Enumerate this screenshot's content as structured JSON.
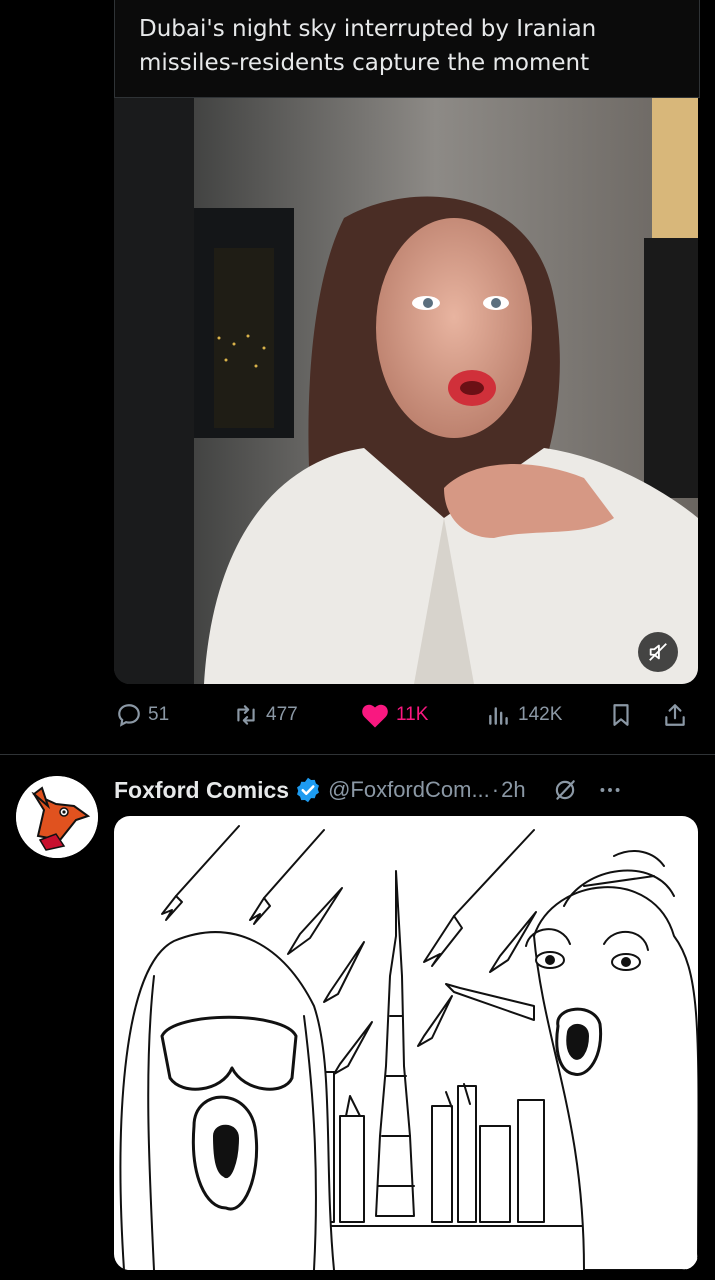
{
  "post": {
    "caption": "Dubai's night sky interrupted by Iranian missiles-residents capture the moment"
  },
  "actions": {
    "replies": "51",
    "reposts": "477",
    "likes": "11K",
    "views": "142K"
  },
  "next_post": {
    "name": "Foxford Comics",
    "handle": "@FoxfordCom...",
    "separator": "·",
    "time": "2h"
  },
  "colors": {
    "background": "#000000",
    "like": "#f91880",
    "verified": "#1d9bf0",
    "muted_text": "#8b98a5"
  },
  "icons": [
    "reply-icon",
    "repost-icon",
    "like-icon",
    "views-icon",
    "bookmark-icon",
    "share-icon",
    "mute-icon",
    "verified-icon",
    "grok-icon",
    "more-icon"
  ]
}
